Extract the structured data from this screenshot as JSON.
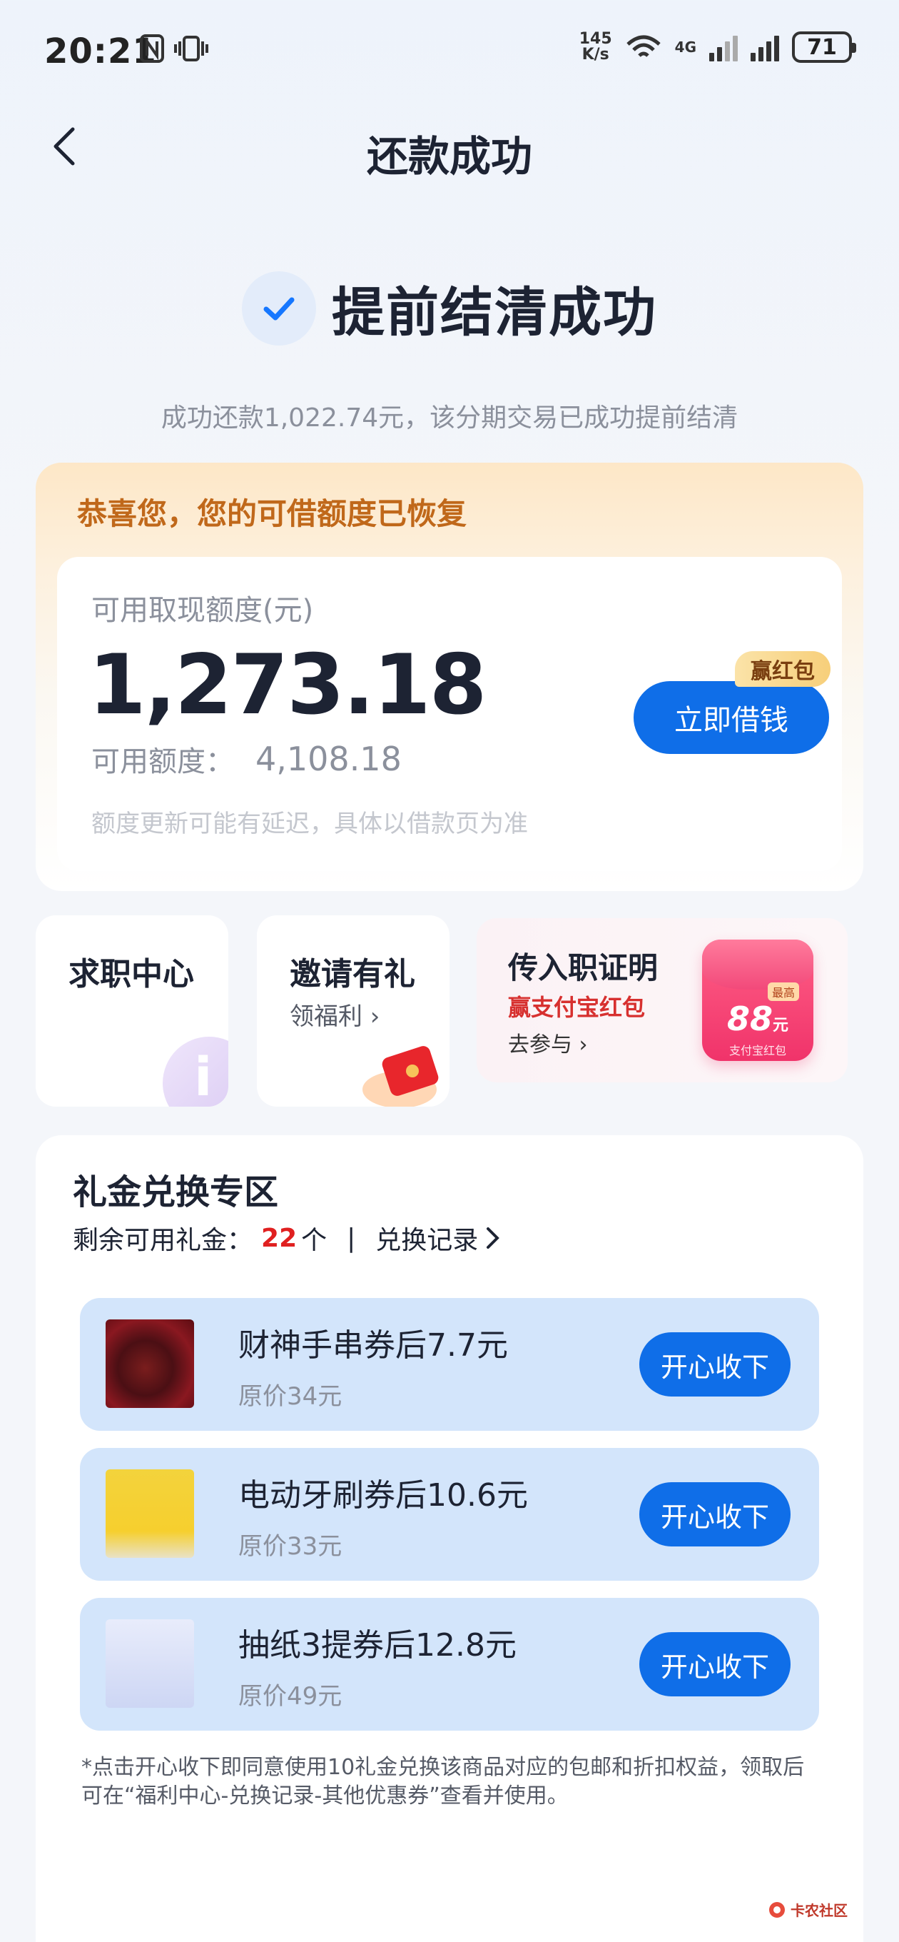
{
  "status_bar": {
    "time": "20:21",
    "speed_top": "145",
    "speed_bottom": "K/s",
    "net1": "4G",
    "battery": "71"
  },
  "header": {
    "title": "还款成功"
  },
  "success": {
    "title": "提前结清成功",
    "description": "成功还款1,022.74元，该分期交易已成功提前结清"
  },
  "quota_card": {
    "congrats": "恭喜您，您的可借额度已恢复",
    "label": "可用取现额度(元)",
    "amount": "1,273.18",
    "available_label": "可用额度：",
    "available_value": "4,108.18",
    "note": "额度更新可能有延迟，具体以借款页为准",
    "borrow_button": "立即借钱",
    "borrow_badge": "赢红包"
  },
  "tiles": [
    {
      "title": "求职中心"
    },
    {
      "title": "邀请有礼",
      "sub": "领福利 ›"
    },
    {
      "title": "传入职证明",
      "sub": "赢支付宝红包",
      "link": "去参与 ›",
      "rp_amount": "88",
      "rp_unit": "元",
      "rp_label": "支付宝红包",
      "rp_badge": "最高"
    }
  ],
  "gift": {
    "title": "礼金兑换专区",
    "remaining_label": "剩余可用礼金：",
    "remaining_count": "22",
    "remaining_unit": "个",
    "separator": "|",
    "record_link": "兑换记录",
    "products": [
      {
        "name": "财神手串券后7.7元",
        "price": "原价34元",
        "button": "开心收下"
      },
      {
        "name": "电动牙刷券后10.6元",
        "price": "原价33元",
        "button": "开心收下"
      },
      {
        "name": "抽纸3提券后12.8元",
        "price": "原价49元",
        "button": "开心收下"
      }
    ],
    "disclaimer": "*点击开心收下即同意使用10礼金兑换该商品对应的包邮和折扣权益，领取后可在“福利中心-兑换记录-其他优惠券”查看并使用。"
  },
  "watermark": {
    "text": "卡农社区"
  },
  "colors": {
    "primary": "#0f6ee8",
    "accent_orange": "#c0681a",
    "accent_red": "#e02020"
  }
}
